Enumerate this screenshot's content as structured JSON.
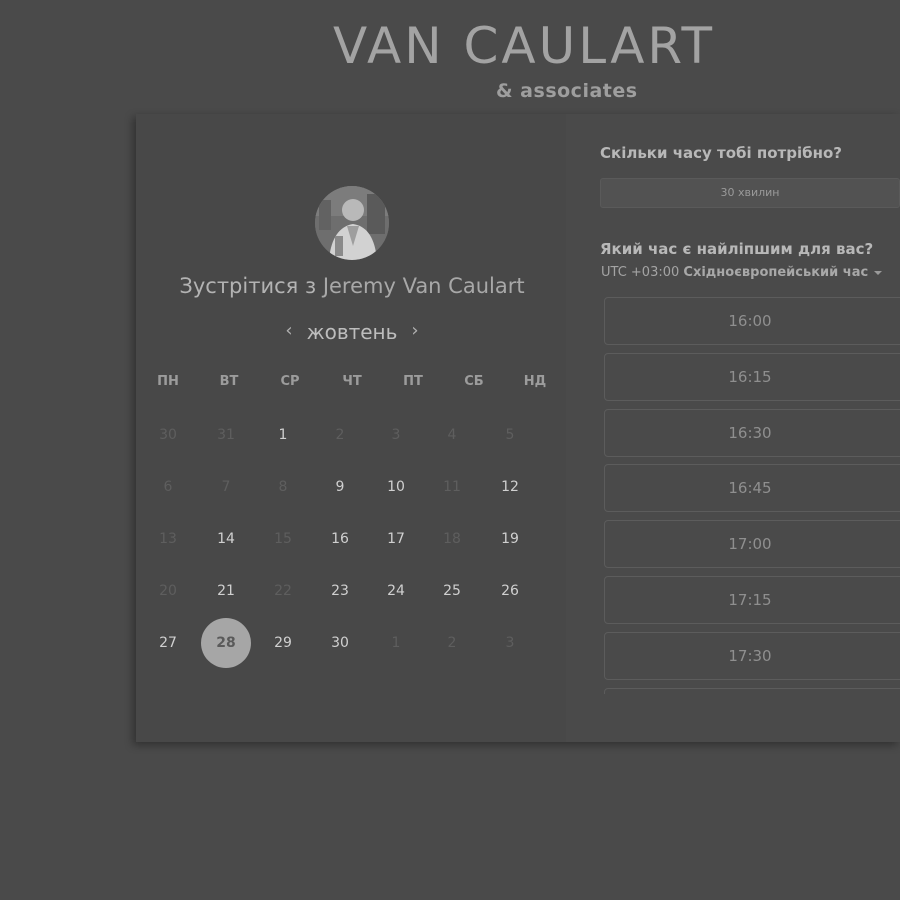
{
  "brand": {
    "name": "VAN CAULART",
    "tagline": "& associates"
  },
  "host": {
    "meet_prefix": "Зустрітися з ",
    "name": "Jeremy Van Caulart"
  },
  "calendar": {
    "month": "жовтень",
    "prev_icon": "chevron-left-icon",
    "next_icon": "chevron-right-icon",
    "weekdays": [
      "ПН",
      "ВТ",
      "СР",
      "ЧТ",
      "ПТ",
      "СБ",
      "НД"
    ],
    "weeks": [
      [
        {
          "d": "30",
          "m": true
        },
        {
          "d": "31",
          "m": true
        },
        {
          "d": "1",
          "m": false
        },
        {
          "d": "2",
          "m": true
        },
        {
          "d": "3",
          "m": true
        },
        {
          "d": "4",
          "m": true
        },
        {
          "d": "5",
          "m": true
        }
      ],
      [
        {
          "d": "6",
          "m": true
        },
        {
          "d": "7",
          "m": true
        },
        {
          "d": "8",
          "m": true
        },
        {
          "d": "9",
          "m": false
        },
        {
          "d": "10",
          "m": false
        },
        {
          "d": "11",
          "m": true
        },
        {
          "d": "12",
          "m": false
        }
      ],
      [
        {
          "d": "13",
          "m": true
        },
        {
          "d": "14",
          "m": false
        },
        {
          "d": "15",
          "m": true
        },
        {
          "d": "16",
          "m": false
        },
        {
          "d": "17",
          "m": false
        },
        {
          "d": "18",
          "m": true
        },
        {
          "d": "19",
          "m": false
        }
      ],
      [
        {
          "d": "20",
          "m": true
        },
        {
          "d": "21",
          "m": false
        },
        {
          "d": "22",
          "m": true
        },
        {
          "d": "23",
          "m": false
        },
        {
          "d": "24",
          "m": false
        },
        {
          "d": "25",
          "m": false
        },
        {
          "d": "26",
          "m": false
        }
      ],
      [
        {
          "d": "27",
          "m": false
        },
        {
          "d": "28",
          "m": false,
          "selected": true
        },
        {
          "d": "29",
          "m": false
        },
        {
          "d": "30",
          "m": false
        },
        {
          "d": "1",
          "m": true
        },
        {
          "d": "2",
          "m": true
        },
        {
          "d": "3",
          "m": true
        }
      ]
    ]
  },
  "booking": {
    "duration_question": "Скільки часу тобі потрібно?",
    "duration_value": "30 хвилин",
    "time_question": "Який час є найліпшим для вас?",
    "timezone_offset": "UTC +03:00",
    "timezone_name": "Східноєвропейський час",
    "slots": [
      "16:00",
      "16:15",
      "16:30",
      "16:45",
      "17:00",
      "17:15",
      "17:30",
      ""
    ]
  }
}
